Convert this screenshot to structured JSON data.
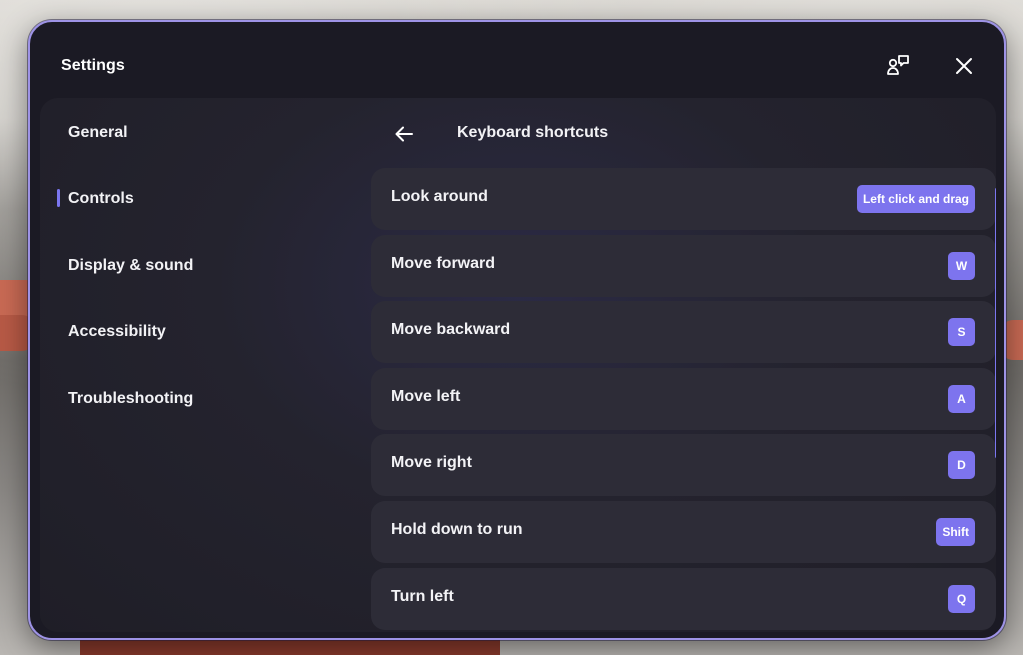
{
  "window": {
    "title": "Settings",
    "feedback_icon": "feedback-icon",
    "close_icon": "close-icon",
    "accent_color": "#7d74ee"
  },
  "sidebar": {
    "items": [
      {
        "label": "General",
        "selected": false
      },
      {
        "label": "Controls",
        "selected": true
      },
      {
        "label": "Display & sound",
        "selected": false
      },
      {
        "label": "Accessibility",
        "selected": false
      },
      {
        "label": "Troubleshooting",
        "selected": false
      }
    ]
  },
  "panel": {
    "back_icon": "arrow-left-icon",
    "title": "Keyboard shortcuts",
    "shortcuts": [
      {
        "action": "Look around",
        "key": "Left click and drag"
      },
      {
        "action": "Move forward",
        "key": "W"
      },
      {
        "action": "Move backward",
        "key": "S"
      },
      {
        "action": "Move left",
        "key": "A"
      },
      {
        "action": "Move right",
        "key": "D"
      },
      {
        "action": "Hold down to run",
        "key": "Shift"
      },
      {
        "action": "Turn left",
        "key": "Q"
      }
    ]
  }
}
